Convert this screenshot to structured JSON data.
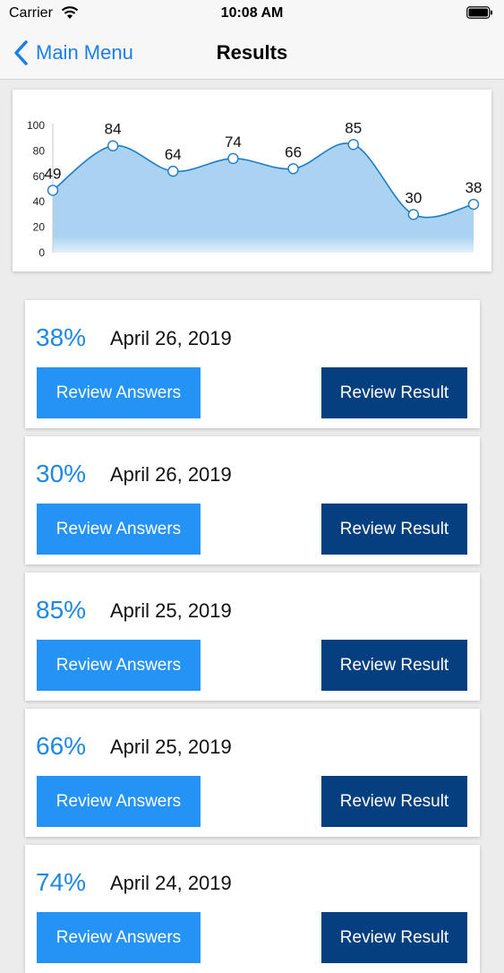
{
  "status_bar": {
    "carrier": "Carrier",
    "time": "10:08 AM"
  },
  "nav": {
    "back_label": "Main Menu",
    "title": "Results"
  },
  "chart_data": {
    "type": "area",
    "x": [
      1,
      2,
      3,
      4,
      5,
      6,
      7,
      8
    ],
    "values": [
      49,
      84,
      64,
      74,
      66,
      85,
      30,
      38
    ],
    "data_labels": [
      "49",
      "84",
      "64",
      "74",
      "66",
      "85",
      "30",
      "38"
    ],
    "y_ticks": [
      "0",
      "20",
      "40",
      "60",
      "80",
      "100"
    ],
    "ylim": [
      0,
      100
    ],
    "grid": false,
    "legend": "none",
    "fill_color": "#a9d3f1",
    "line_color": "#1f7cc7"
  },
  "results": [
    {
      "score": "38%",
      "date": "April 26, 2019",
      "review_answers": "Review Answers",
      "review_result": "Review Result"
    },
    {
      "score": "30%",
      "date": "April 26, 2019",
      "review_answers": "Review Answers",
      "review_result": "Review Result"
    },
    {
      "score": "85%",
      "date": "April 25, 2019",
      "review_answers": "Review Answers",
      "review_result": "Review Result"
    },
    {
      "score": "66%",
      "date": "April 25, 2019",
      "review_answers": "Review Answers",
      "review_result": "Review Result"
    },
    {
      "score": "74%",
      "date": "April 24, 2019",
      "review_answers": "Review Answers",
      "review_result": "Review Result"
    }
  ],
  "colors": {
    "accent": "#1a7ef0",
    "primary_button": "#2593f5",
    "secondary_button": "#053f80",
    "score_text": "#1e88e5"
  }
}
